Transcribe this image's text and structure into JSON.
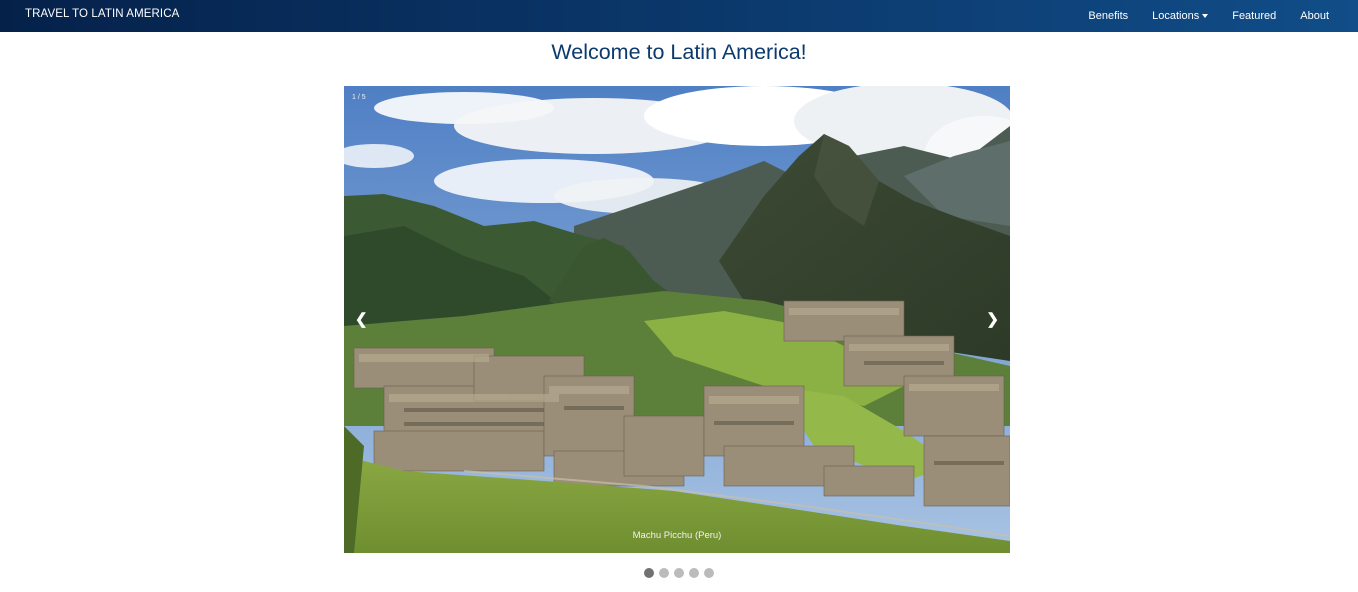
{
  "navbar": {
    "brand": "TRAVEL TO LATIN AMERICA",
    "links": [
      {
        "label": "Benefits"
      },
      {
        "label": "Locations",
        "has_dropdown": true
      },
      {
        "label": "Featured"
      },
      {
        "label": "About"
      }
    ]
  },
  "page": {
    "title": "Welcome to Latin America!"
  },
  "slideshow": {
    "counter": "1 / 5",
    "prev_symbol": "❮",
    "next_symbol": "❯",
    "current_caption": "Machu Picchu (Peru)",
    "current_slide": 1,
    "total_slides": 5
  },
  "colors": {
    "nav_start": "#05214a",
    "nav_end": "#114d88",
    "title": "#0b3a6e",
    "dot_active": "#717171",
    "dot_inactive": "#bbbbbb"
  },
  "icons": {
    "locations_dropdown": "caret-down-icon",
    "prev": "chevron-left-icon",
    "next": "chevron-right-icon"
  }
}
